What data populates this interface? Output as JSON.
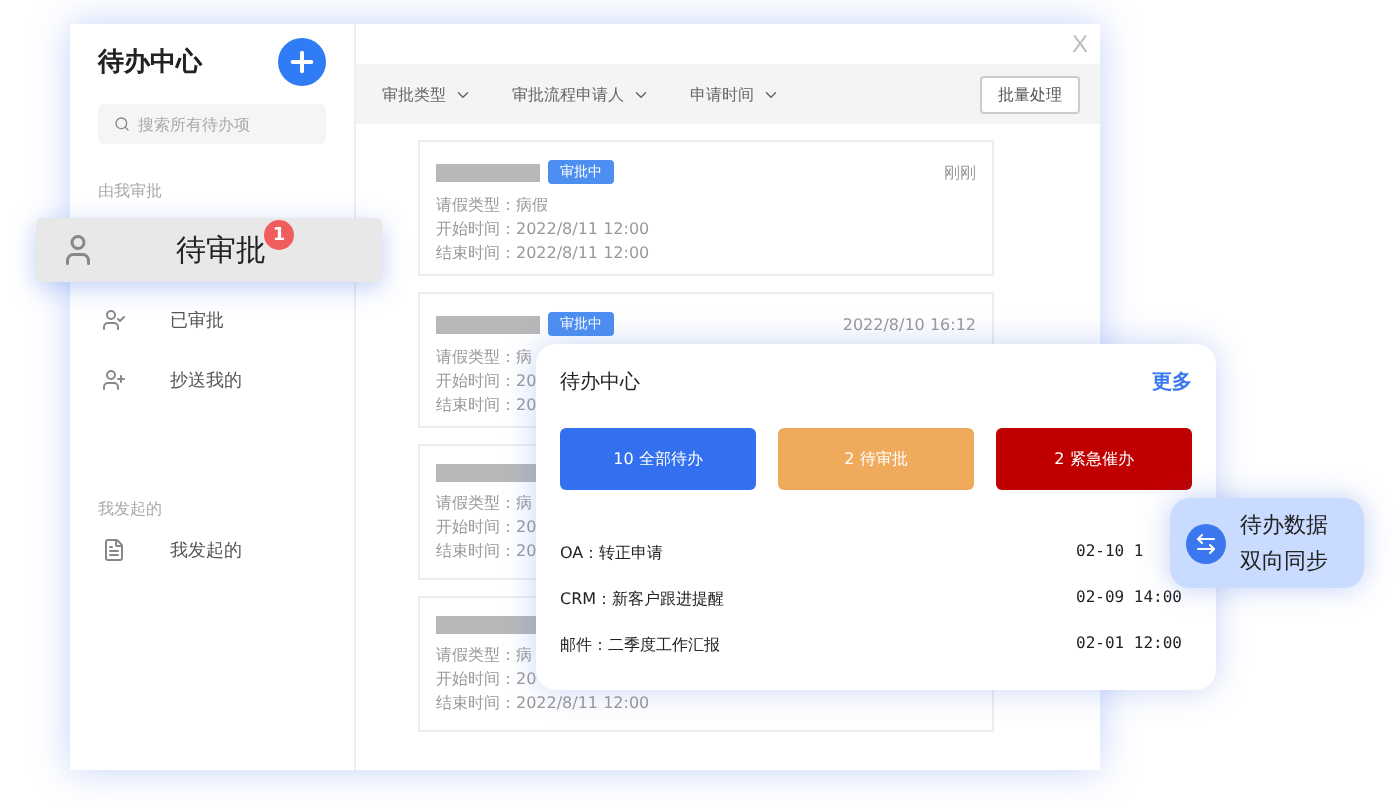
{
  "window": {
    "close": "X"
  },
  "sidebar": {
    "title": "待办中心",
    "search": {
      "placeholder": "搜索所有待办项"
    },
    "sections": [
      {
        "heading": "由我审批",
        "items": [
          {
            "label": "待审批",
            "kind": "pending",
            "selected": true,
            "badge": "1"
          },
          {
            "label": "已审批",
            "kind": "approved",
            "selected": false
          },
          {
            "label": "抄送我的",
            "kind": "cc",
            "selected": false
          }
        ]
      },
      {
        "heading": "我发起的",
        "items": [
          {
            "label": "我发起的",
            "kind": "initiated",
            "selected": false
          }
        ]
      }
    ]
  },
  "filters": [
    {
      "label": "审批类型"
    },
    {
      "label": "审批流程申请人"
    },
    {
      "label": "申请时间"
    }
  ],
  "batch_button": "批量处理",
  "cards": [
    {
      "tag": "审批中",
      "time": "刚刚",
      "lines": [
        "请假类型：病假",
        "开始时间：2022/8/11 12:00",
        "结束时间：2022/8/11 12:00"
      ]
    },
    {
      "tag": "审批中",
      "time": "2022/8/10 16:12",
      "lines": [
        "请假类型：病",
        "开始时间：20",
        "结束时间：20"
      ]
    },
    {
      "lines": [
        "请假类型：病",
        "开始时间：20",
        "结束时间：20"
      ]
    },
    {
      "lines": [
        "请假类型：病",
        "开始时间：20",
        "结束时间：2022/8/11 12:00"
      ]
    }
  ],
  "popup": {
    "title": "待办中心",
    "more": "更多",
    "stats": [
      {
        "label": "10  全部待办",
        "color": "#3370f0"
      },
      {
        "label": "2 待审批",
        "color": "#efaa5c"
      },
      {
        "label": "2 紧急催办",
        "color": "#c00000"
      }
    ],
    "rows": [
      {
        "name": "OA：转正申请",
        "time": "02-10 1"
      },
      {
        "name": "CRM：新客户跟进提醒",
        "time": "02-09 14:00"
      },
      {
        "name": "邮件：二季度工作汇报",
        "time": "02-01 12:00"
      }
    ]
  },
  "sync_badge": {
    "lines": [
      "待办数据",
      "双向同步"
    ]
  }
}
